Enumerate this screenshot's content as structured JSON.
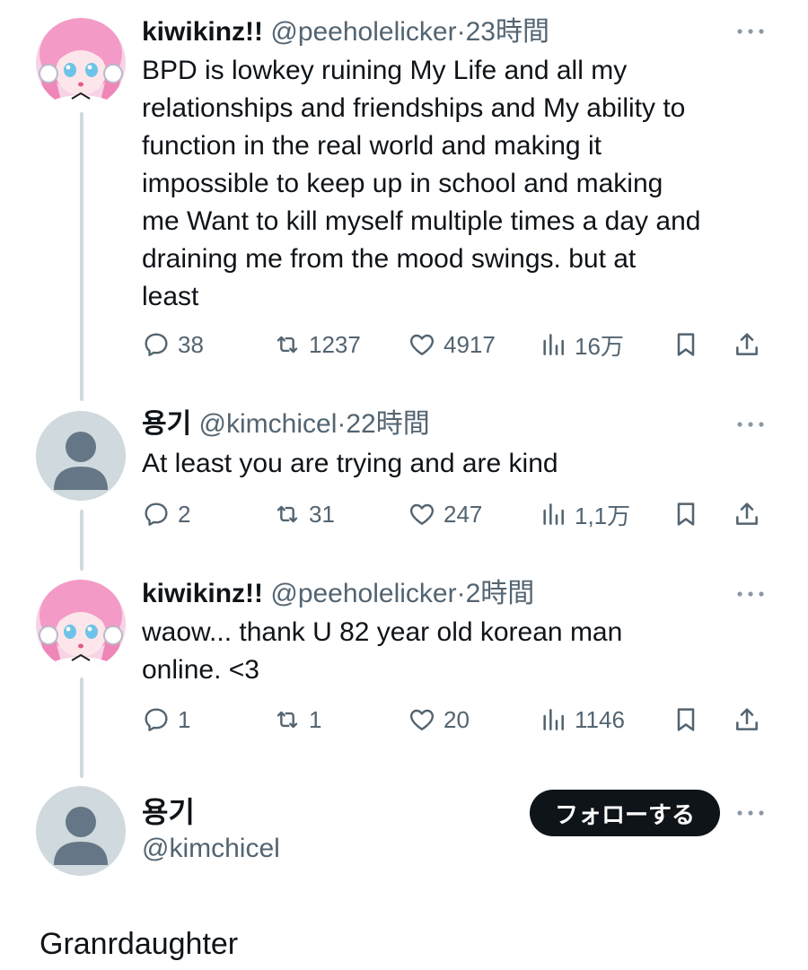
{
  "thread": [
    {
      "name": "kiwikinz!!",
      "handle": "@peeholelicker",
      "separator": "·",
      "time": "23時間",
      "text_lines": [
        "BPD is lowkey ruining My Life and all my",
        "relationships and friendships and My ability to",
        "function in the real world and making it",
        "impossible to keep up in school  and making",
        "me Want to kill myself multiple times a day and",
        "draining me from the mood swings. but at",
        "least"
      ],
      "replies": "38",
      "reposts": "1237",
      "likes": "4917",
      "views": "16万",
      "avatar": "anime-girl-avatar"
    },
    {
      "name": "용기",
      "handle": "@kimchicel",
      "separator": "·",
      "time": "22時間",
      "text_lines": [
        "At least you are trying and are kind"
      ],
      "replies": "2",
      "reposts": "31",
      "likes": "247",
      "views": "1,1万",
      "avatar": "default-profile-avatar"
    },
    {
      "name": "kiwikinz!!",
      "handle": "@peeholelicker",
      "separator": "·",
      "time": "2時間",
      "text_lines": [
        "waow... thank U 82 year old korean man",
        "online. <3"
      ],
      "replies": "1",
      "reposts": "1",
      "likes": "20",
      "views": "1146",
      "avatar": "anime-girl-avatar"
    }
  ],
  "profile": {
    "name": "용기",
    "handle": "@kimchicel",
    "follow_label": "フォローする"
  },
  "caption": "Granrdaughter",
  "icons": {
    "reply": "reply-icon",
    "repost": "repost-icon",
    "like": "heart-icon",
    "views": "views-icon",
    "bookmark": "bookmark-icon",
    "share": "share-icon",
    "more": "more-icon"
  },
  "colors": {
    "text": "#0f1419",
    "secondary": "#536471",
    "thread_line": "#cfd9de",
    "button": "#0f1419",
    "button_text": "#ffffff",
    "avatar_default_bg": "#cfd9de",
    "avatar_default_fg": "#657786"
  }
}
